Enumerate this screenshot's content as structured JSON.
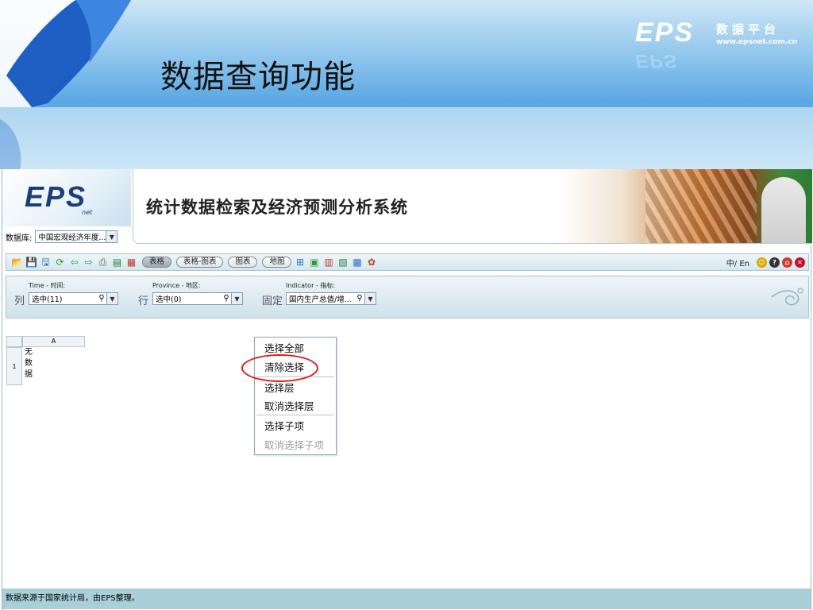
{
  "slide": {
    "title": "数据查询功能",
    "brand_logo": "EPS",
    "brand_logo_sub": "net",
    "brand_cn": "数据平台",
    "brand_url": "www.epsnet.com.cn"
  },
  "app": {
    "logo": "EPS",
    "logo_sub": "net",
    "title": "统计数据检索及经济预测分析系统",
    "database": {
      "label": "数据库:",
      "selected": "中国宏观经济年度..."
    }
  },
  "toolbar": {
    "view_tabs": [
      "表格",
      "表格-图表",
      "图表",
      "地图"
    ],
    "active_tab": "表格",
    "language": "中/ En",
    "icons": [
      "open-icon",
      "save-icon",
      "save-as-icon",
      "refresh-icon",
      "back-icon",
      "forward-icon",
      "print-icon",
      "export-icon",
      "chart-type-icon"
    ],
    "right_icons": [
      "user-icon",
      "help-icon",
      "home-icon",
      "exit-icon"
    ]
  },
  "selector": {
    "column": {
      "axis": "列",
      "dimension": "Time - 时间:",
      "selected": "选中(11)"
    },
    "row": {
      "axis": "行",
      "dimension": "Province - 地区:",
      "selected": "选中(0)"
    },
    "fixed": {
      "axis": "固定",
      "dimension": "Indicator - 指标:",
      "selected": "国内生产总值/增..."
    }
  },
  "grid": {
    "column_header": "A",
    "row_number": "1",
    "cell": "无数据"
  },
  "context_menu": {
    "items": [
      {
        "label": "选择全部",
        "enabled": true
      },
      {
        "label": "清除选择",
        "enabled": true
      },
      {
        "label": "选择层",
        "enabled": true
      },
      {
        "label": "取消选择层",
        "enabled": true
      },
      {
        "label": "选择子项",
        "enabled": true
      },
      {
        "label": "取消选择子项",
        "enabled": false
      }
    ],
    "highlighted": "清除选择"
  },
  "footer": {
    "source": "数据来源于国家统计局，由EPS整理。"
  },
  "colors": {
    "accent_red": "#e21a1a",
    "panel": "#d4e6ee",
    "footer": "#a9cfd8"
  }
}
